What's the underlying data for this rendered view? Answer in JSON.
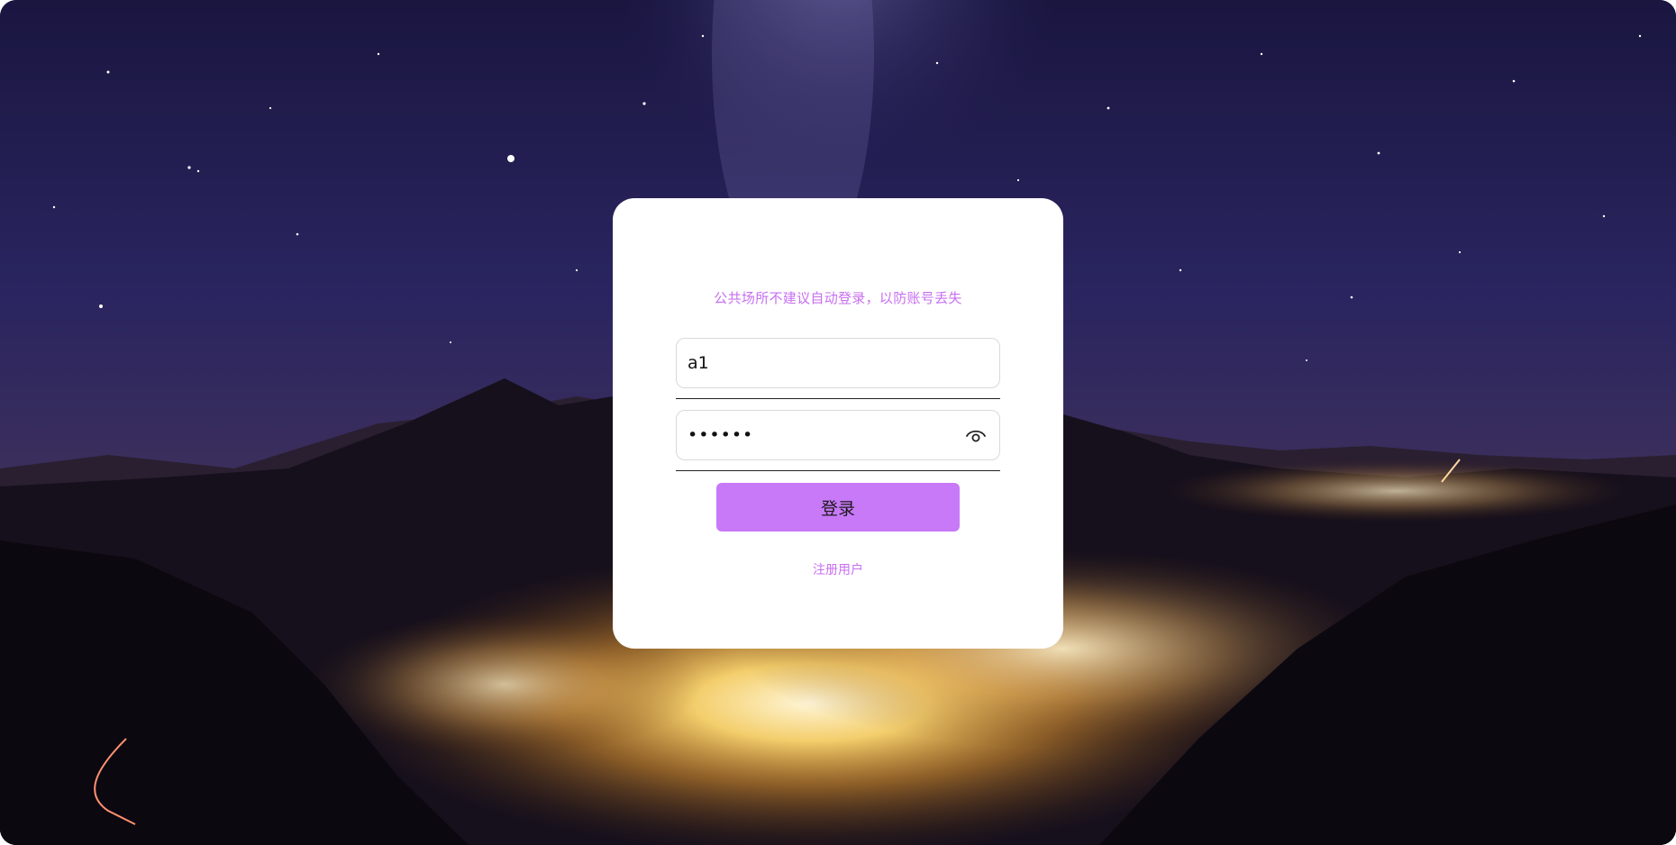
{
  "login": {
    "hint": "公共场所不建议自动登录，以防账号丢失",
    "username_value": "a1",
    "password_value": "••••••",
    "submit_label": "登录",
    "register_label": "注册用户"
  },
  "icons": {
    "password_toggle": "eye-icon"
  },
  "colors": {
    "accent": "#c879f7",
    "hint_text": "#c86ff0",
    "card_background": "#ffffff"
  }
}
